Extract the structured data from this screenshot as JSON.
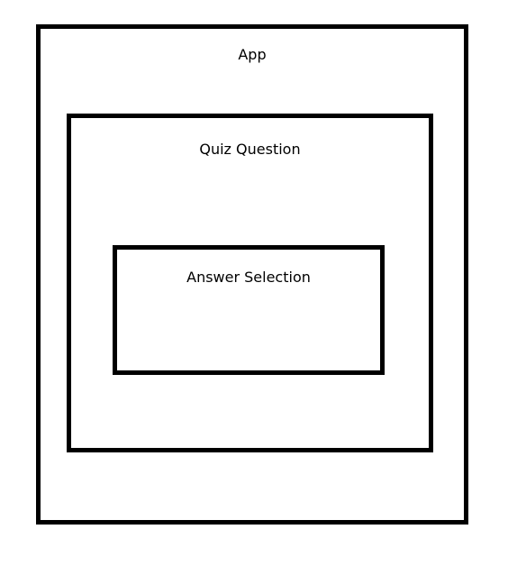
{
  "diagram": {
    "app": {
      "label": "App"
    },
    "quiz_question": {
      "label": "Quiz Question"
    },
    "answer_selection": {
      "label": "Answer Selection"
    }
  },
  "colors": {
    "stroke": "#000000",
    "background": "#ffffff"
  }
}
